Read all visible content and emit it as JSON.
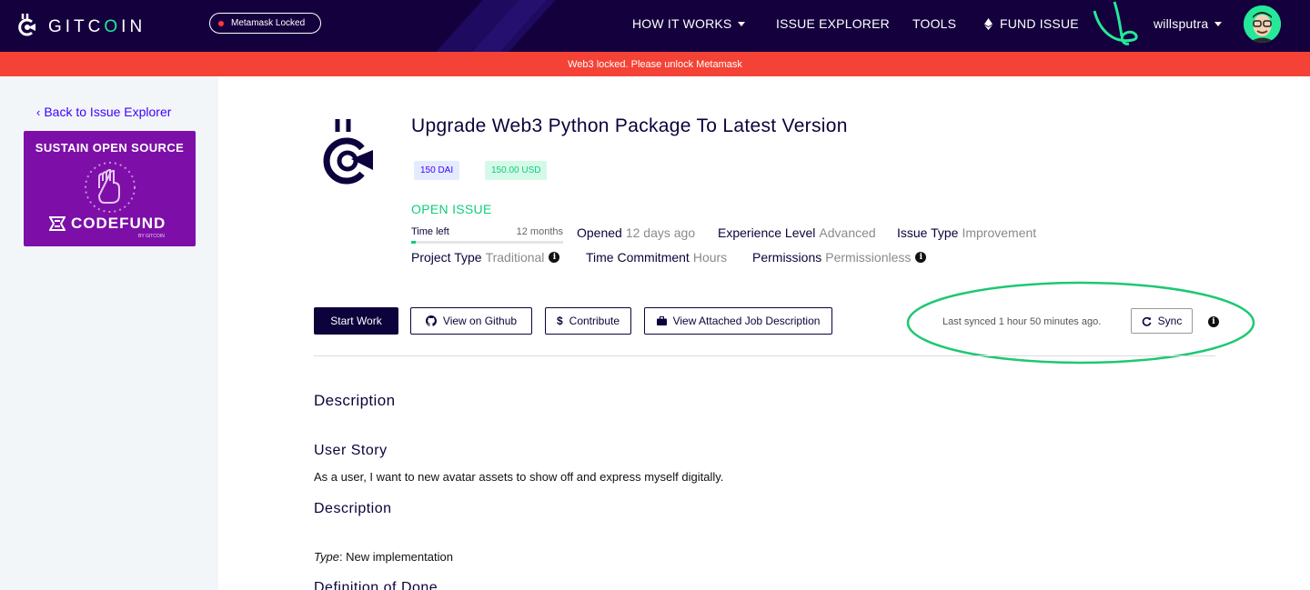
{
  "navbar": {
    "brand_left": "GITC",
    "brand_o": "O",
    "brand_right": "IN",
    "metamask_status": "Metamask Locked",
    "items": [
      {
        "label": "HOW IT WORKS"
      },
      {
        "label": "ISSUE EXPLORER"
      },
      {
        "label": "TOOLS"
      },
      {
        "label": "FUND ISSUE"
      }
    ],
    "username": "willsputra"
  },
  "alert": {
    "text": "Web3 locked. Please unlock Metamask"
  },
  "sidebar": {
    "back_label": "Back to Issue Explorer",
    "ad_title": "SUSTAIN OPEN SOURCE",
    "ad_brand": "CODEFUND",
    "ad_sub": "BY GITCOIN"
  },
  "issue": {
    "title": "Upgrade Web3 Python Package To Latest Version",
    "amount_token": "150 DAI",
    "amount_usd": "150.00 USD",
    "status": "OPEN ISSUE",
    "time_left_label": "Time left",
    "time_left_value": "12 months",
    "time_left_fraction": 0.03,
    "meta": {
      "opened_k": "Opened",
      "opened_v": "12 days ago",
      "experience_k": "Experience Level",
      "experience_v": "Advanced",
      "issue_type_k": "Issue Type",
      "issue_type_v": "Improvement",
      "project_type_k": "Project Type",
      "project_type_v": "Traditional",
      "time_commit_k": "Time Commitment",
      "time_commit_v": "Hours",
      "permissions_k": "Permissions",
      "permissions_v": "Permissionless"
    }
  },
  "actions": {
    "start_work": "Start Work",
    "view_github": "View on Github",
    "contribute": "Contribute",
    "view_job": "View Attached Job Description",
    "last_synced": "Last synced 1 hour 50 minutes ago.",
    "sync": "Sync"
  },
  "content": {
    "description_heading": "Description",
    "user_story_heading": "User Story",
    "user_story_text": "As a user, I want to new avatar assets to show off and express myself digitally.",
    "description2_heading": "Description",
    "type_label": "Type",
    "type_value": ": New implementation",
    "dod_heading": "Definition of Done"
  },
  "colors": {
    "navbar": "#15003e",
    "alert": "#f44336",
    "accent_green": "#0fce7c",
    "primary": "#0d023b",
    "link": "#3e00ff"
  }
}
